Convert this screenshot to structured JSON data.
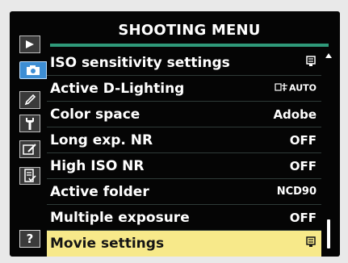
{
  "menu": {
    "title": "SHOOTING MENU",
    "tabs": [
      {
        "name": "playback-tab",
        "icon": "play-icon"
      },
      {
        "name": "shooting-tab",
        "icon": "camera-icon",
        "active": true
      },
      {
        "name": "custom-settings-tab",
        "icon": "pencil-icon"
      },
      {
        "name": "setup-tab",
        "icon": "wrench-icon"
      },
      {
        "name": "retouch-tab",
        "icon": "retouch-brush-icon"
      },
      {
        "name": "my-menu-tab",
        "icon": "recent-settings-icon"
      },
      {
        "name": "help-tab",
        "label": "?"
      }
    ],
    "items": [
      {
        "label": "ISO sensitivity settings",
        "value": "",
        "value_icon": "menu-page-icon"
      },
      {
        "label": "Active D-Lighting",
        "value": "AUTO",
        "value_icon": "d-lighting-icon"
      },
      {
        "label": "Color space",
        "value": "Adobe"
      },
      {
        "label": "Long exp. NR",
        "value": "OFF"
      },
      {
        "label": "High ISO NR",
        "value": "OFF"
      },
      {
        "label": "Active folder",
        "value": "NCD90"
      },
      {
        "label": "Multiple exposure",
        "value": "OFF"
      },
      {
        "label": "Movie settings",
        "value": "",
        "value_icon": "menu-page-icon",
        "selected": true
      }
    ]
  },
  "colors": {
    "screen_bg": "#050505",
    "accent_rule": "#2f9a7a",
    "active_tab": "#3d8ed4",
    "highlight": "#f7e98a"
  }
}
